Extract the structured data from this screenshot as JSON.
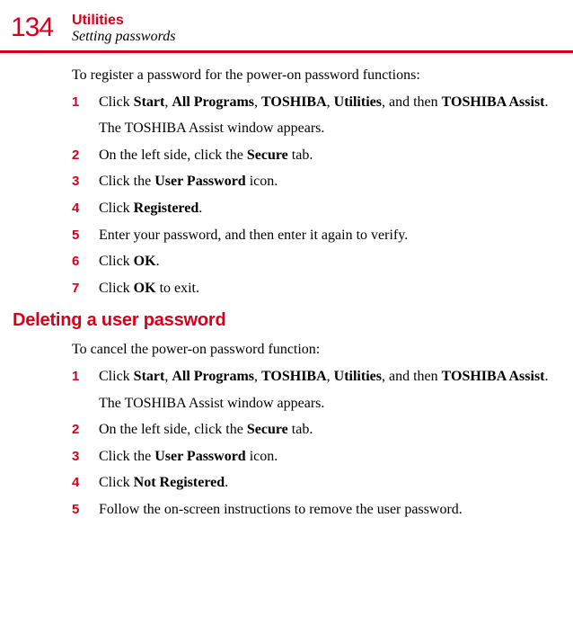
{
  "header": {
    "page_number": "134",
    "chapter": "Utilities",
    "section": "Setting passwords"
  },
  "blocks": [
    {
      "intro": "To register a password for the power-on password functions:",
      "steps": [
        {
          "n": "1",
          "html": "Click <b>Start</b>, <b>All Programs</b>, <b>TOSHIBA</b>, <b>Utilities</b>, and then <b>TOSHIBA Assist</b>.",
          "after": "The TOSHIBA Assist window appears."
        },
        {
          "n": "2",
          "html": "On the left side, click the <b>Secure</b> tab."
        },
        {
          "n": "3",
          "html": "Click the <b>User Password</b> icon."
        },
        {
          "n": "4",
          "html": "Click <b>Registered</b>."
        },
        {
          "n": "5",
          "html": "Enter your password, and then enter it again to verify."
        },
        {
          "n": "6",
          "html": "Click <b>OK</b>."
        },
        {
          "n": "7",
          "html": "Click <b>OK</b> to exit."
        }
      ]
    },
    {
      "heading": "Deleting a user password",
      "intro": "To cancel the power-on password function:",
      "steps": [
        {
          "n": "1",
          "html": "Click <b>Start</b>, <b>All Programs</b>, <b>TOSHIBA</b>, <b>Utilities</b>, and then <b>TOSHIBA Assist</b>.",
          "after": "The TOSHIBA Assist window appears."
        },
        {
          "n": "2",
          "html": "On the left side, click the <b>Secure</b> tab."
        },
        {
          "n": "3",
          "html": "Click the <b>User Password</b> icon."
        },
        {
          "n": "4",
          "html": "Click <b>Not Registered</b>."
        },
        {
          "n": "5",
          "html": "Follow the on-screen instructions to remove the user password."
        }
      ]
    }
  ]
}
